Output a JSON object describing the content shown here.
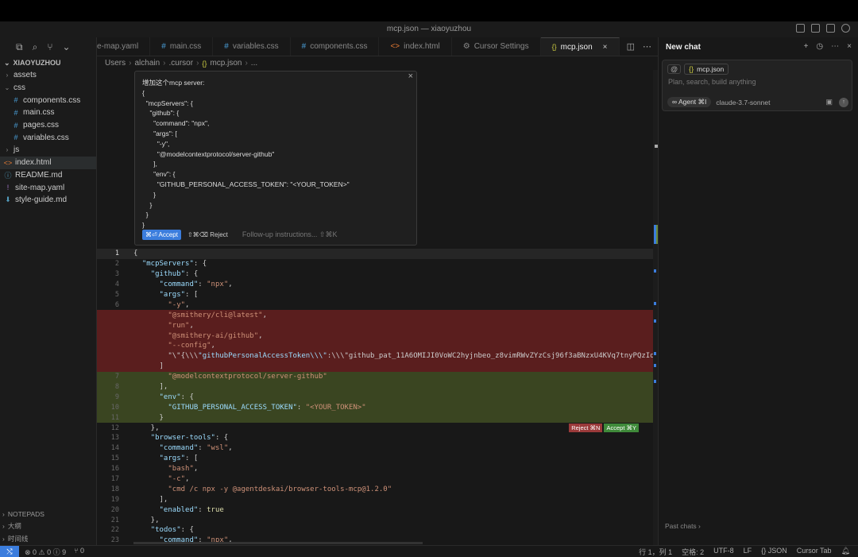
{
  "window": {
    "title": "mcp.json — xiaoyuzhou"
  },
  "sidebar": {
    "explorer_title": "XIAOYUZHOU",
    "items": [
      {
        "label": "assets",
        "type": "folder",
        "expanded": false,
        "indent": 1
      },
      {
        "label": "css",
        "type": "folder",
        "expanded": true,
        "indent": 1
      },
      {
        "label": "components.css",
        "type": "css",
        "indent": 2
      },
      {
        "label": "main.css",
        "type": "css",
        "indent": 2
      },
      {
        "label": "pages.css",
        "type": "css",
        "indent": 2
      },
      {
        "label": "variables.css",
        "type": "css",
        "indent": 2
      },
      {
        "label": "js",
        "type": "folder",
        "expanded": false,
        "indent": 1
      },
      {
        "label": "index.html",
        "type": "html",
        "indent": 1,
        "active": true
      },
      {
        "label": "README.md",
        "type": "md",
        "indent": 1
      },
      {
        "label": "site-map.yaml",
        "type": "yaml",
        "indent": 1
      },
      {
        "label": "style-guide.md",
        "type": "dl",
        "indent": 1
      }
    ],
    "sections": [
      "NOTEPADS",
      "大纲",
      "时间线"
    ]
  },
  "tabs": [
    {
      "label": "e-map.yaml",
      "icon": "yaml"
    },
    {
      "label": "main.css",
      "icon": "#"
    },
    {
      "label": "variables.css",
      "icon": "#"
    },
    {
      "label": "components.css",
      "icon": "#"
    },
    {
      "label": "index.html",
      "icon": "html"
    },
    {
      "label": "Cursor Settings",
      "icon": "gear"
    },
    {
      "label": "mcp.json",
      "icon": "{}",
      "active": true
    }
  ],
  "breadcrumb": [
    "Users",
    "alchain",
    ".cursor",
    "mcp.json",
    "..."
  ],
  "popup": {
    "message": "增加这个mcp server:\n{\n  \"mcpServers\": {\n    \"github\": {\n      \"command\": \"npx\",\n      \"args\": [\n        \"-y\",\n        \"@modelcontextprotocol/server-github\"\n      ],\n      \"env\": {\n        \"GITHUB_PERSONAL_ACCESS_TOKEN\": \"<YOUR_TOKEN>\"\n      }\n    }\n  }\n}",
    "accept_label": "⌘⏎ Accept",
    "reject_label": "⇧⌘⌫ Reject",
    "followup_label": "Follow-up instructions... ⇧⌘K"
  },
  "code_lines": [
    {
      "n": "1",
      "text": "{",
      "kind": "curline"
    },
    {
      "n": "2",
      "text": "  \"mcpServers\": {",
      "kind": ""
    },
    {
      "n": "3",
      "text": "    \"github\": {",
      "kind": ""
    },
    {
      "n": "4",
      "text": "      \"command\": \"npx\",",
      "kind": ""
    },
    {
      "n": "5",
      "text": "      \"args\": [",
      "kind": ""
    },
    {
      "n": "6",
      "text": "        \"-y\",",
      "kind": ""
    },
    {
      "n": "",
      "text": "        \"@smithery/cli@latest\",",
      "kind": "del"
    },
    {
      "n": "",
      "text": "        \"run\",",
      "kind": "del"
    },
    {
      "n": "",
      "text": "        \"@smithery-ai/github\",",
      "kind": "del"
    },
    {
      "n": "",
      "text": "        \"--config\",",
      "kind": "del"
    },
    {
      "n": "",
      "text": "        \"\\\"{\\\\\\\"githubPersonalAccessToken\\\\\\\":\\\\\\\"github_pat_11A6OMIJI0VoWC2hyjnbeo_z8vimRWvZYzCsj96f3aBNzxU4KVq7tnyPQzIdgNeAYI",
      "kind": "del"
    },
    {
      "n": "",
      "text": "      ]",
      "kind": "del"
    },
    {
      "n": "7",
      "text": "        \"@modelcontextprotocol/server-github\"",
      "kind": "add"
    },
    {
      "n": "8",
      "text": "      ],",
      "kind": "add"
    },
    {
      "n": "9",
      "text": "      \"env\": {",
      "kind": "add"
    },
    {
      "n": "10",
      "text": "        \"GITHUB_PERSONAL_ACCESS_TOKEN\": \"<YOUR_TOKEN>\"",
      "kind": "add"
    },
    {
      "n": "11",
      "text": "      }",
      "kind": "add"
    },
    {
      "n": "12",
      "text": "    },",
      "kind": ""
    },
    {
      "n": "13",
      "text": "    \"browser-tools\": {",
      "kind": ""
    },
    {
      "n": "14",
      "text": "      \"command\": \"wsl\",",
      "kind": ""
    },
    {
      "n": "15",
      "text": "      \"args\": [",
      "kind": ""
    },
    {
      "n": "16",
      "text": "        \"bash\",",
      "kind": ""
    },
    {
      "n": "17",
      "text": "        \"-c\",",
      "kind": ""
    },
    {
      "n": "18",
      "text": "        \"cmd /c npx -y @agentdeskai/browser-tools-mcp@1.2.0\"",
      "kind": ""
    },
    {
      "n": "19",
      "text": "      ],",
      "kind": ""
    },
    {
      "n": "20",
      "text": "      \"enabled\": true",
      "kind": ""
    },
    {
      "n": "21",
      "text": "    },",
      "kind": ""
    },
    {
      "n": "22",
      "text": "    \"todos\": {",
      "kind": ""
    },
    {
      "n": "23",
      "text": "      \"command\": \"npx\",",
      "kind": ""
    }
  ],
  "inline_review": {
    "reject": "Reject ⌘N",
    "accept": "Accept ⌘Y"
  },
  "chat": {
    "title": "New chat",
    "context_chip": "mcp.json",
    "placeholder": "Plan, search, build anything",
    "agent_label": "∞ Agent ⌘I",
    "model": "claude-3.7-sonnet",
    "past_chats": "Past chats"
  },
  "statusbar": {
    "problems": "⊗ 0 ⚠ 0 ⓘ 9",
    "ports": "⑂ 0",
    "position": "行 1，列 1",
    "spaces": "空格: 2",
    "encoding": "UTF-8",
    "eol": "LF",
    "language": "{} JSON",
    "cursor_tab": "Cursor Tab"
  },
  "colors": {
    "accent": "#3b7ddd",
    "deleted_bg": "#5a1e1e",
    "added_bg": "#3a4521"
  }
}
